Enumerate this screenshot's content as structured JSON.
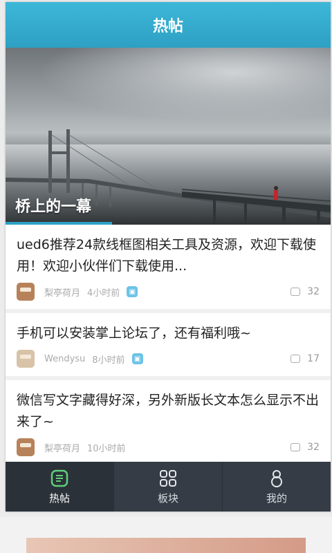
{
  "header": {
    "title": "热帖"
  },
  "hero": {
    "caption": "桥上的一幕"
  },
  "posts": [
    {
      "title": "ued6推荐24款线框图相关工具及资源，欢迎下载使用！欢迎小伙伴们下载使用...",
      "author": "梨亭荷月",
      "time": "4小时前",
      "comments": "32"
    },
    {
      "title": "手机可以安装掌上论坛了，还有福利哦~",
      "author": "Wendysu",
      "time": "8小时前",
      "comments": "17"
    },
    {
      "title": "微信写文字藏得好深，另外新版长文本怎么显示不出来了~",
      "author": "梨亭荷月",
      "time": "10小时前",
      "comments": "32"
    }
  ],
  "tabbar": {
    "items": [
      {
        "label": "热帖",
        "icon": "hot-posts-icon",
        "active": true
      },
      {
        "label": "板块",
        "icon": "grid-icon",
        "active": false
      },
      {
        "label": "我的",
        "icon": "profile-icon",
        "active": false
      }
    ]
  },
  "colors": {
    "accent": "#2ea0c4",
    "tabbar": "#353c45"
  }
}
